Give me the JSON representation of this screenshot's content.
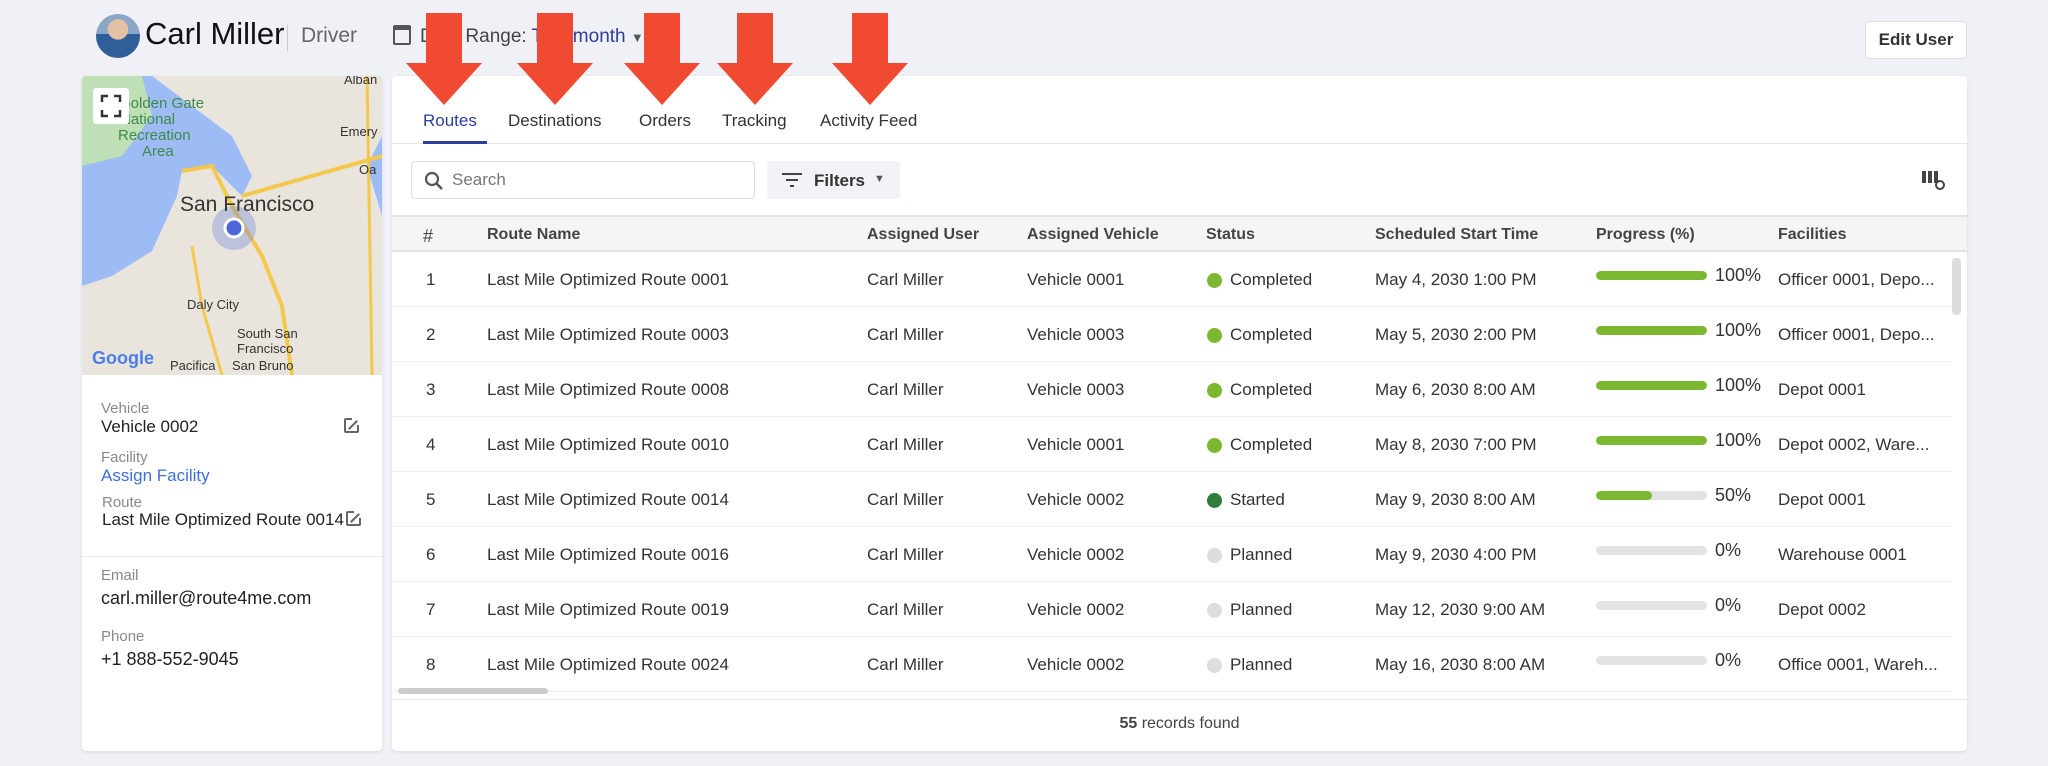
{
  "header": {
    "name": "Carl Miller",
    "role": "Driver",
    "date_range_label": "Date Range:",
    "date_range_value": "This month",
    "edit_button": "Edit User"
  },
  "map": {
    "labels": [
      "Golden Gate",
      "National",
      "Recreation",
      "Area",
      "San Francisco",
      "Daly City",
      "South San",
      "Francisco",
      "Pacifica",
      "San Bruno",
      "Alban",
      "Emery",
      "Oa"
    ],
    "logo": "Google"
  },
  "profile": {
    "vehicle_label": "Vehicle",
    "vehicle": "Vehicle 0002",
    "facility_label": "Facility",
    "facility_link": "Assign Facility",
    "route_label": "Route",
    "route": "Last Mile Optimized Route 0014",
    "email_label": "Email",
    "email": "carl.miller@route4me.com",
    "phone_label": "Phone",
    "phone": "+1 888-552-9045"
  },
  "tabs": [
    {
      "label": "Routes",
      "active": true
    },
    {
      "label": "Destinations"
    },
    {
      "label": "Orders"
    },
    {
      "label": "Tracking"
    },
    {
      "label": "Activity Feed"
    }
  ],
  "toolbar": {
    "search_placeholder": "Search",
    "filters_label": "Filters"
  },
  "table": {
    "columns": [
      "#",
      "Route Name",
      "Assigned User",
      "Assigned Vehicle",
      "Status",
      "Scheduled Start Time",
      "Progress (%)",
      "Facilities"
    ],
    "rows": [
      {
        "n": "1",
        "name": "Last Mile Optimized Route 0001",
        "user": "Carl Miller",
        "vehicle": "Vehicle 0001",
        "status": "Completed",
        "start": "May 4, 2030 1:00 PM",
        "progress": 100,
        "progress_label": "100%",
        "facilities": "Officer 0001, Depo..."
      },
      {
        "n": "2",
        "name": "Last Mile Optimized Route 0003",
        "user": "Carl Miller",
        "vehicle": "Vehicle 0003",
        "status": "Completed",
        "start": "May 5, 2030 2:00 PM",
        "progress": 100,
        "progress_label": "100%",
        "facilities": "Officer 0001, Depo..."
      },
      {
        "n": "3",
        "name": "Last Mile Optimized Route 0008",
        "user": "Carl Miller",
        "vehicle": "Vehicle 0003",
        "status": "Completed",
        "start": "May 6, 2030 8:00 AM",
        "progress": 100,
        "progress_label": "100%",
        "facilities": "Depot 0001"
      },
      {
        "n": "4",
        "name": "Last Mile Optimized Route 0010",
        "user": "Carl Miller",
        "vehicle": "Vehicle 0001",
        "status": "Completed",
        "start": "May 8, 2030 7:00 PM",
        "progress": 100,
        "progress_label": "100%",
        "facilities": "Depot 0002, Ware..."
      },
      {
        "n": "5",
        "name": "Last Mile Optimized Route 0014",
        "user": "Carl Miller",
        "vehicle": "Vehicle 0002",
        "status": "Started",
        "start": "May 9, 2030 8:00 AM",
        "progress": 50,
        "progress_label": "50%",
        "facilities": "Depot 0001"
      },
      {
        "n": "6",
        "name": "Last Mile Optimized Route 0016",
        "user": "Carl Miller",
        "vehicle": "Vehicle 0002",
        "status": "Planned",
        "start": "May 9, 2030 4:00 PM",
        "progress": 0,
        "progress_label": "0%",
        "facilities": "Warehouse 0001"
      },
      {
        "n": "7",
        "name": "Last Mile Optimized Route 0019",
        "user": "Carl Miller",
        "vehicle": "Vehicle 0002",
        "status": "Planned",
        "start": "May 12, 2030 9:00 AM",
        "progress": 0,
        "progress_label": "0%",
        "facilities": "Depot 0002"
      },
      {
        "n": "8",
        "name": "Last Mile Optimized Route 0024",
        "user": "Carl Miller",
        "vehicle": "Vehicle 0002",
        "status": "Planned",
        "start": "May 16, 2030 8:00 AM",
        "progress": 0,
        "progress_label": "0%",
        "facilities": "Office 0001, Wareh..."
      }
    ]
  },
  "status_colors": {
    "Completed": "#7cb82f",
    "Started": "#2e7d3a",
    "Planned": "#dddddd"
  },
  "footer": {
    "count": "55",
    "suffix": " records found"
  },
  "annotation": {
    "arrow_color": "#f04a32"
  }
}
